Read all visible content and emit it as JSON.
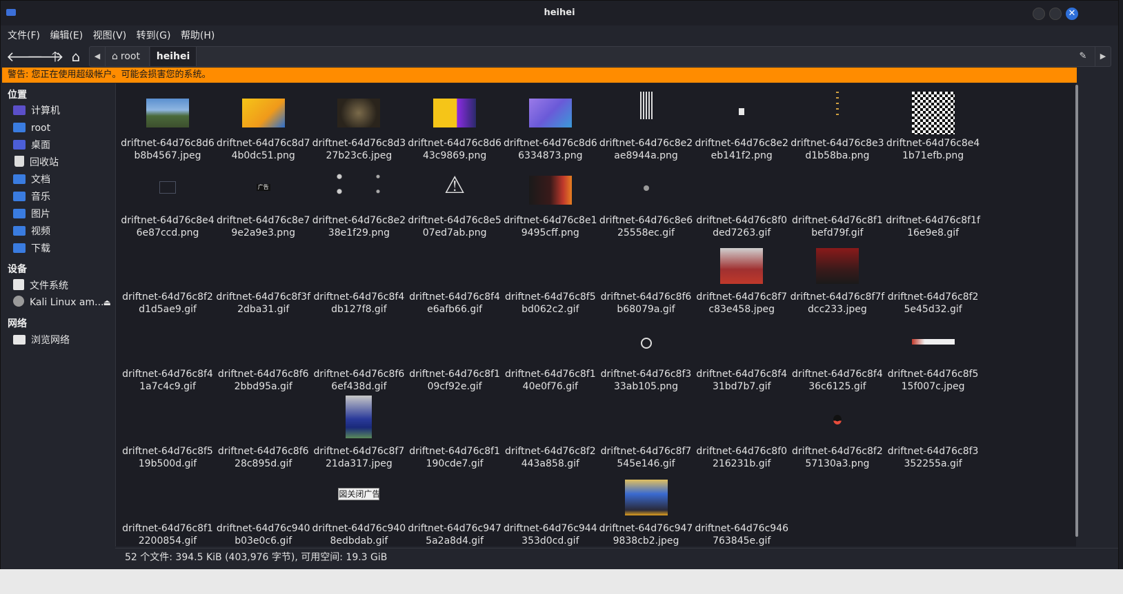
{
  "window": {
    "title": "heihei",
    "close_glyph": "✕"
  },
  "menu": [
    "文件(F)",
    "编辑(E)",
    "视图(V)",
    "转到(G)",
    "帮助(H)"
  ],
  "path": {
    "root_label": "root",
    "current_label": "heihei"
  },
  "warning": "警告: 您正在使用超级帐户。可能会损害您的系统。",
  "sidebar": {
    "places_header": "位置",
    "places": [
      "计算机",
      "root",
      "桌面",
      "回收站",
      "文档",
      "音乐",
      "图片",
      "视频",
      "下载"
    ],
    "devices_header": "设备",
    "devices": [
      "文件系统",
      "Kali Linux am..."
    ],
    "network_header": "网络",
    "network": [
      "浏览网络"
    ]
  },
  "files": [
    {
      "name": "driftnet-64d76c8d6b8b4567.jpeg",
      "thumb": "photo-landscape"
    },
    {
      "name": "driftnet-64d76c8d74b0dc51.png",
      "thumb": "banner-yellow"
    },
    {
      "name": "driftnet-64d76c8d327b23c6.jpeg",
      "thumb": "photo-dark"
    },
    {
      "name": "driftnet-64d76c8d643c9869.png",
      "thumb": "banner-colorful"
    },
    {
      "name": "driftnet-64d76c8d66334873.png",
      "thumb": "banner-purple"
    },
    {
      "name": "driftnet-64d76c8e2ae8944a.png",
      "thumb": "tiny-pattern"
    },
    {
      "name": "driftnet-64d76c8e2eb141f2.png",
      "thumb": "tiny-arrow"
    },
    {
      "name": "driftnet-64d76c8e3d1b58ba.png",
      "thumb": "tiny-dots"
    },
    {
      "name": "driftnet-64d76c8e41b71efb.png",
      "thumb": "qr-code"
    },
    {
      "name": "driftnet-64d76c8e46e87ccd.png",
      "thumb": "chat-icon"
    },
    {
      "name": "driftnet-64d76c8e79e2a9e3.png",
      "thumb": "ad-badge"
    },
    {
      "name": "driftnet-64d76c8e238e1f29.png",
      "thumb": "tiny-icons"
    },
    {
      "name": "driftnet-64d76c8e507ed7ab.png",
      "thumb": "warning-icon"
    },
    {
      "name": "driftnet-64d76c8e19495cff.png",
      "thumb": "banner-dark-red"
    },
    {
      "name": "driftnet-64d76c8e625558ec.gif",
      "thumb": "tiny-dot"
    },
    {
      "name": "driftnet-64d76c8f0ded7263.gif",
      "thumb": ""
    },
    {
      "name": "driftnet-64d76c8f1befd79f.gif",
      "thumb": ""
    },
    {
      "name": "driftnet-64d76c8f1f16e9e8.gif",
      "thumb": ""
    },
    {
      "name": "driftnet-64d76c8f2d1d5ae9.gif",
      "thumb": ""
    },
    {
      "name": "driftnet-64d76c8f3f2dba31.gif",
      "thumb": ""
    },
    {
      "name": "driftnet-64d76c8f4db127f8.gif",
      "thumb": ""
    },
    {
      "name": "driftnet-64d76c8f4e6afb66.gif",
      "thumb": ""
    },
    {
      "name": "driftnet-64d76c8f5bd062c2.gif",
      "thumb": ""
    },
    {
      "name": "driftnet-64d76c8f6b68079a.gif",
      "thumb": ""
    },
    {
      "name": "driftnet-64d76c8f7c83e458.jpeg",
      "thumb": "photo-red-news"
    },
    {
      "name": "driftnet-64d76c8f7fdcc233.jpeg",
      "thumb": "photo-red-dark"
    },
    {
      "name": "driftnet-64d76c8f25e45d32.gif",
      "thumb": ""
    },
    {
      "name": "driftnet-64d76c8f41a7c4c9.gif",
      "thumb": ""
    },
    {
      "name": "driftnet-64d76c8f62bbd95a.gif",
      "thumb": ""
    },
    {
      "name": "driftnet-64d76c8f66ef438d.gif",
      "thumb": ""
    },
    {
      "name": "driftnet-64d76c8f109cf92e.gif",
      "thumb": ""
    },
    {
      "name": "driftnet-64d76c8f140e0f76.gif",
      "thumb": ""
    },
    {
      "name": "driftnet-64d76c8f333ab105.png",
      "thumb": "refresh-icon"
    },
    {
      "name": "driftnet-64d76c8f431bd7b7.gif",
      "thumb": ""
    },
    {
      "name": "driftnet-64d76c8f436c6125.gif",
      "thumb": ""
    },
    {
      "name": "driftnet-64d76c8f515f007c.jpeg",
      "thumb": "thin-banner"
    },
    {
      "name": "driftnet-64d76c8f519b500d.gif",
      "thumb": ""
    },
    {
      "name": "driftnet-64d76c8f628c895d.gif",
      "thumb": ""
    },
    {
      "name": "driftnet-64d76c8f721da317.jpeg",
      "thumb": "photo-tall-ad"
    },
    {
      "name": "driftnet-64d76c8f1190cde7.gif",
      "thumb": ""
    },
    {
      "name": "driftnet-64d76c8f2443a858.gif",
      "thumb": ""
    },
    {
      "name": "driftnet-64d76c8f7545e146.gif",
      "thumb": ""
    },
    {
      "name": "driftnet-64d76c8f0216231b.gif",
      "thumb": ""
    },
    {
      "name": "driftnet-64d76c8f257130a3.png",
      "thumb": "penguin-icon"
    },
    {
      "name": "driftnet-64d76c8f3352255a.gif",
      "thumb": ""
    },
    {
      "name": "driftnet-64d76c8f12200854.gif",
      "thumb": ""
    },
    {
      "name": "driftnet-64d76c940b03e0c6.gif",
      "thumb": ""
    },
    {
      "name": "driftnet-64d76c9408edbdab.gif",
      "thumb": "close-ad-button"
    },
    {
      "name": "driftnet-64d76c9475a2a8d4.gif",
      "thumb": ""
    },
    {
      "name": "driftnet-64d76c944353d0cd.gif",
      "thumb": ""
    },
    {
      "name": "driftnet-64d76c9479838cb2.jpeg",
      "thumb": "photo-news-blue"
    },
    {
      "name": "driftnet-64d76c946763845e.gif",
      "thumb": ""
    }
  ],
  "thumb_texts": {
    "ad_badge": "广告",
    "close_ad": "図关闭广告"
  },
  "status": "52 个文件: 394.5 KiB (403,976 字节), 可用空间: 19.3 GiB",
  "colors": {
    "warning_bg": "#ff8c00",
    "accent": "#2e6fd8"
  }
}
